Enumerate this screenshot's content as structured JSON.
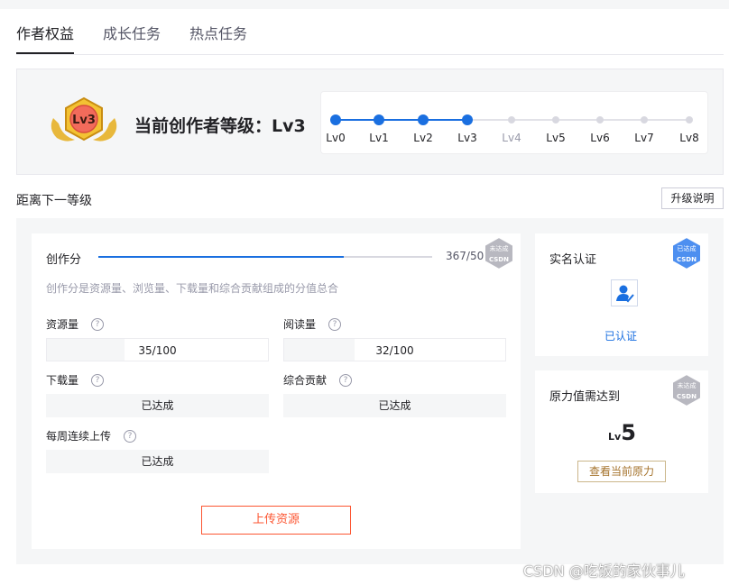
{
  "tabs": [
    {
      "label": "作者权益"
    },
    {
      "label": "成长任务"
    },
    {
      "label": "热点任务"
    }
  ],
  "level": {
    "badge": "Lv3",
    "title": "当前创作者等级：Lv3",
    "steps": [
      {
        "label": "Lv0",
        "reached": true
      },
      {
        "label": "Lv1",
        "reached": true
      },
      {
        "label": "Lv2",
        "reached": true
      },
      {
        "label": "Lv3",
        "reached": true
      },
      {
        "label": "Lv4",
        "reached": false
      },
      {
        "label": "Lv5",
        "reached": false
      },
      {
        "label": "Lv6",
        "reached": false
      },
      {
        "label": "Lv7",
        "reached": false
      },
      {
        "label": "Lv8",
        "reached": false
      }
    ]
  },
  "next": {
    "section_title": "距离下一等级",
    "upgrade_label": "升级说明"
  },
  "score": {
    "label": "创作分",
    "value_text": "367/500",
    "current": 367,
    "target": 500,
    "status_stamp": "未达成",
    "description": "创作分是资源量、浏览量、下载量和综合贡献组成的分值总合"
  },
  "fields": {
    "resources": {
      "label": "资源量",
      "value": "35/100",
      "progress": 0.35
    },
    "reads": {
      "label": "阅读量",
      "value": "32/100",
      "progress": 0.32
    },
    "downloads": {
      "label": "下载量",
      "value": "已达成"
    },
    "contribution": {
      "label": "综合贡献",
      "value": "已达成"
    },
    "weekly_upload": {
      "label": "每周连续上传",
      "value": "已达成"
    }
  },
  "upload_label": "上传资源",
  "realname": {
    "title": "实名认证",
    "status": "已认证",
    "stamp": "已达成"
  },
  "power": {
    "title": "原力值需达到",
    "level_prefix": "Lv",
    "level_num": "5",
    "button": "查看当前原力",
    "stamp": "未达成"
  },
  "stamp_brand": "CSDN",
  "watermark": "CSDN @吃饭的家伙事儿",
  "colors": {
    "accent": "#1a6fe0",
    "upload": "#fc5531",
    "gold": "#a5732c"
  }
}
